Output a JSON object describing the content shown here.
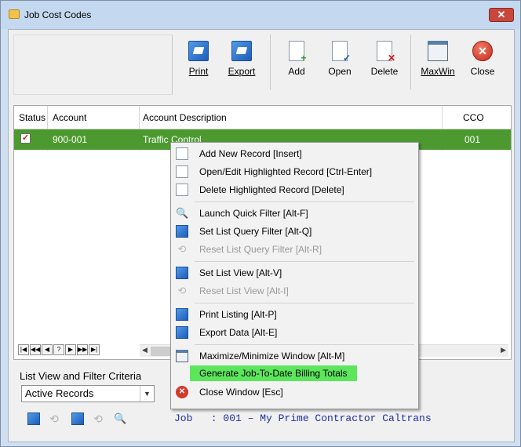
{
  "window": {
    "title": "Job Cost Codes",
    "close_glyph": "✕"
  },
  "toolbar": {
    "print": "Print",
    "export": "Export",
    "add": "Add",
    "open": "Open",
    "delete": "Delete",
    "maxwin": "MaxWin",
    "close": "Close"
  },
  "grid": {
    "headers": [
      "Status",
      "Account",
      "Account Description",
      "CCO"
    ],
    "rows": [
      {
        "status_checked": true,
        "account": "900-001",
        "description": "Traffic Control",
        "cco": "001"
      }
    ],
    "nav_buttons": [
      "|◀",
      "◀◀",
      "◀",
      "?",
      "▶",
      "▶▶",
      "▶|"
    ]
  },
  "filter": {
    "label": "List View and Filter Criteria",
    "selected": "Active Records"
  },
  "status_line": "Job   : 001 – My Prime Contractor Caltrans",
  "context_menu": {
    "items": [
      {
        "label": "Add New Record  [Insert]",
        "icon": "add-doc-icon",
        "enabled": true
      },
      {
        "label": "Open/Edit Highlighted Record  [Ctrl-Enter]",
        "icon": "edit-doc-icon",
        "enabled": true
      },
      {
        "label": "Delete Highlighted Record  [Delete]",
        "icon": "delete-doc-icon",
        "enabled": true
      },
      {
        "label": "Launch Quick Filter  [Alt-F]",
        "icon": "magnifier-icon",
        "enabled": true
      },
      {
        "label": "Set List Query Filter  [Alt-Q]",
        "icon": "query-filter-icon",
        "enabled": true
      },
      {
        "label": "Reset List Query Filter  [Alt-R]",
        "icon": "reset-filter-icon",
        "enabled": false
      },
      {
        "label": "Set List View  [Alt-V]",
        "icon": "list-view-icon",
        "enabled": true
      },
      {
        "label": "Reset List View  [Alt-I]",
        "icon": "reset-view-icon",
        "enabled": false
      },
      {
        "label": "Print Listing  [Alt-P]",
        "icon": "print-icon",
        "enabled": true
      },
      {
        "label": "Export Data  [Alt-E]",
        "icon": "export-icon",
        "enabled": true
      },
      {
        "label": "Maximize/Minimize Window  [Alt-M]",
        "icon": "window-icon",
        "enabled": true
      },
      {
        "label": "Generate Job-To-Date Billing Totals",
        "icon": "",
        "enabled": true,
        "highlighted": true
      },
      {
        "label": "Close Window  [Esc]",
        "icon": "close-circle-icon",
        "enabled": true
      }
    ]
  },
  "colors": {
    "selected_row": "#4c9a2f",
    "highlight_item": "#5ce65c",
    "status_text": "#1c2ea0"
  }
}
